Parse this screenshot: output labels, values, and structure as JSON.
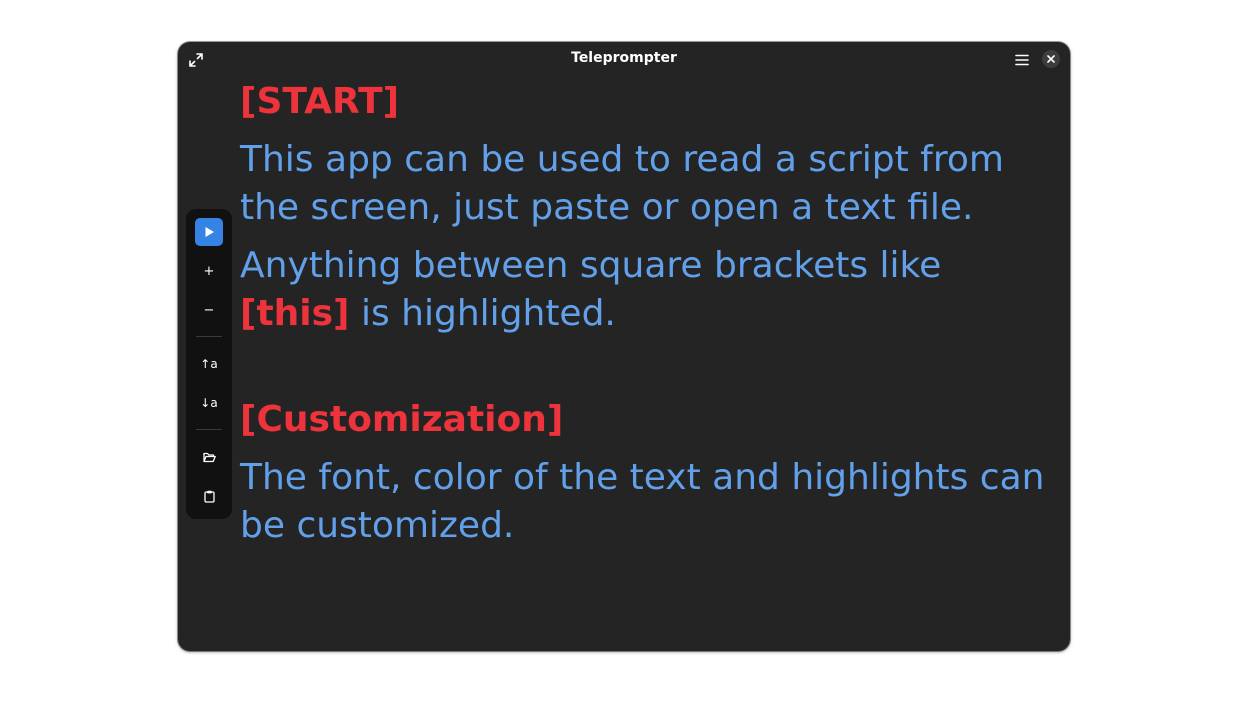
{
  "window": {
    "title": "Teleprompter"
  },
  "icons": {
    "fullscreen": "fullscreen-icon",
    "menu": "hamburger-menu-icon",
    "close": "close-icon",
    "play": "play-icon",
    "increase_size": "plus-icon",
    "decrease_size": "minus-icon",
    "scroll_up_speed": "speed-up-icon",
    "scroll_down_speed": "speed-down-icon",
    "open_file": "folder-open-icon",
    "paste": "clipboard-icon"
  },
  "toolbar": {
    "plus_glyph": "+",
    "minus_glyph": "−",
    "up_glyph": "↑a",
    "down_glyph": "↓a"
  },
  "script": {
    "heading_start": "[START]",
    "para1": "This app can be used to read a script from the screen, just paste or open a text file.",
    "para2_before": "Anything between square brackets like ",
    "para2_highlight": "[this]",
    "para2_after": " is highlighted.",
    "heading_custom": "[Customization]",
    "para3": "The font, color of the text and highlights can be customized."
  },
  "colors": {
    "text": "#62a0ea",
    "highlight": "#ed333b",
    "background": "#242424",
    "accent": "#3584e4"
  }
}
